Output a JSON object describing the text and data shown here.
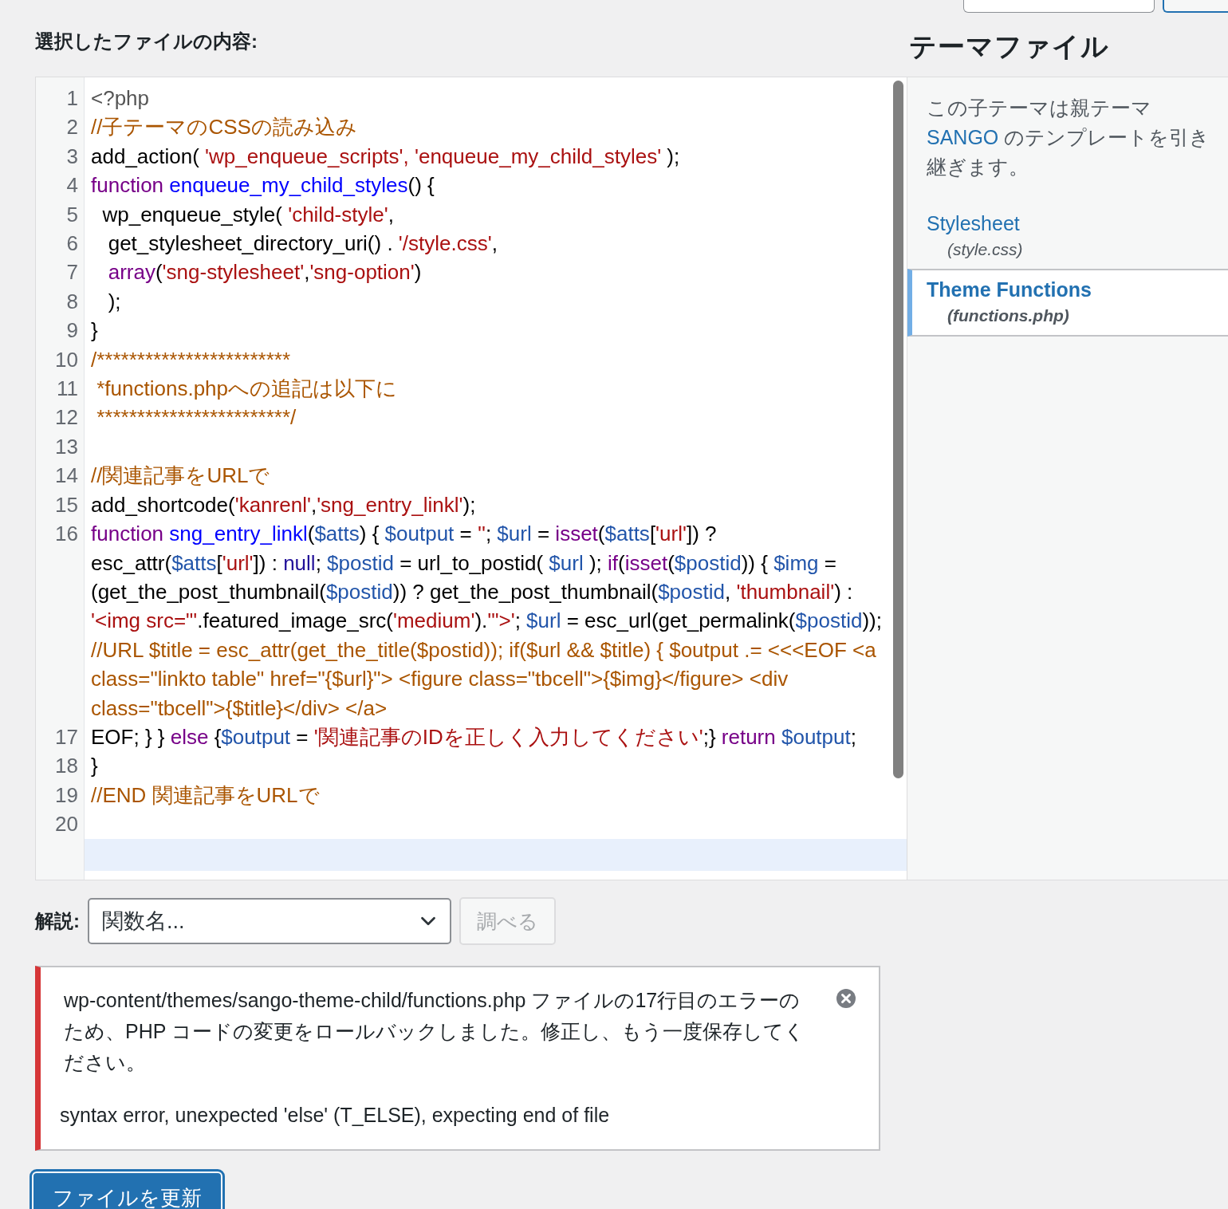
{
  "header": {
    "title": "選択したファイルの内容:"
  },
  "editor": {
    "lines": [
      {
        "number": "1",
        "tokens": [
          {
            "t": "<?php",
            "kind": "meta"
          }
        ]
      },
      {
        "number": "2",
        "tokens": [
          {
            "t": "//子テーマのCSSの読み込み",
            "kind": "comment"
          }
        ]
      },
      {
        "number": "3",
        "tokens": [
          {
            "t": "add_action( ",
            "kind": "plain"
          },
          {
            "t": "'wp_enqueue_scripts',",
            "kind": "string"
          },
          {
            "t": " 'enqueue_my_child_styles'",
            "kind": "string"
          },
          {
            "t": " );",
            "kind": "plain"
          }
        ]
      },
      {
        "number": "4",
        "tokens": [
          {
            "t": "function ",
            "kind": "keyword"
          },
          {
            "t": "enqueue_my_child_styles",
            "kind": "def"
          },
          {
            "t": "() {",
            "kind": "plain"
          }
        ]
      },
      {
        "number": "5",
        "tokens": [
          {
            "t": "  wp_enqueue_style( ",
            "kind": "plain"
          },
          {
            "t": "'child-style'",
            "kind": "string"
          },
          {
            "t": ",",
            "kind": "plain"
          }
        ]
      },
      {
        "number": "6",
        "tokens": [
          {
            "t": "   get_stylesheet_directory_uri() . ",
            "kind": "plain"
          },
          {
            "t": "'/style.css'",
            "kind": "string"
          },
          {
            "t": ",",
            "kind": "plain"
          }
        ]
      },
      {
        "number": "7",
        "tokens": [
          {
            "t": "   array",
            "kind": "keyword"
          },
          {
            "t": "(",
            "kind": "plain"
          },
          {
            "t": "'sng-stylesheet'",
            "kind": "string"
          },
          {
            "t": ",",
            "kind": "plain"
          },
          {
            "t": "'sng-option'",
            "kind": "string"
          },
          {
            "t": ")",
            "kind": "plain"
          }
        ]
      },
      {
        "number": "8",
        "tokens": [
          {
            "t": "   );",
            "kind": "plain"
          }
        ]
      },
      {
        "number": "9",
        "tokens": [
          {
            "t": "}",
            "kind": "plain"
          }
        ]
      },
      {
        "number": "10",
        "tokens": [
          {
            "t": "/************************",
            "kind": "comment"
          }
        ]
      },
      {
        "number": "11",
        "tokens": [
          {
            "t": " *functions.phpへの追記は以下に",
            "kind": "comment"
          }
        ]
      },
      {
        "number": "12",
        "tokens": [
          {
            "t": " ************************/",
            "kind": "comment"
          }
        ]
      },
      {
        "number": "13"
      },
      {
        "number": "14",
        "tokens": [
          {
            "t": "//関連記事をURLで",
            "kind": "comment"
          }
        ]
      },
      {
        "number": "15",
        "tokens": [
          {
            "t": "add_shortcode(",
            "kind": "plain"
          },
          {
            "t": "'kanrenl'",
            "kind": "string"
          },
          {
            "t": ",",
            "kind": "plain"
          },
          {
            "t": "'sng_entry_linkl'",
            "kind": "string"
          },
          {
            "t": ");",
            "kind": "plain"
          }
        ]
      },
      {
        "number": "16",
        "tokens": [
          {
            "t": "function ",
            "kind": "keyword"
          },
          {
            "t": "sng_entry_linkl",
            "kind": "def"
          },
          {
            "t": "(",
            "kind": "plain"
          },
          {
            "t": "$atts",
            "kind": "variable"
          },
          {
            "t": ") { ",
            "kind": "plain"
          },
          {
            "t": "$output",
            "kind": "variable"
          },
          {
            "t": " = ",
            "kind": "plain"
          },
          {
            "t": "''",
            "kind": "string"
          },
          {
            "t": "; ",
            "kind": "plain"
          },
          {
            "t": "$url",
            "kind": "variable"
          },
          {
            "t": " = ",
            "kind": "plain"
          },
          {
            "t": "isset",
            "kind": "keyword"
          },
          {
            "t": "(",
            "kind": "plain"
          },
          {
            "t": "$atts",
            "kind": "variable"
          },
          {
            "t": "[",
            "kind": "plain"
          },
          {
            "t": "'url'",
            "kind": "string"
          },
          {
            "t": "]) ? esc_attr(",
            "kind": "plain"
          },
          {
            "t": "$atts",
            "kind": "variable"
          },
          {
            "t": "[",
            "kind": "plain"
          },
          {
            "t": "'url'",
            "kind": "string"
          },
          {
            "t": "]) : ",
            "kind": "plain"
          },
          {
            "t": "null",
            "kind": "atom"
          },
          {
            "t": "; ",
            "kind": "plain"
          },
          {
            "t": "$postid",
            "kind": "variable"
          },
          {
            "t": " = url_to_postid( ",
            "kind": "plain"
          },
          {
            "t": "$url",
            "kind": "variable"
          },
          {
            "t": " ); ",
            "kind": "plain"
          },
          {
            "t": "if",
            "kind": "keyword"
          },
          {
            "t": "(",
            "kind": "plain"
          },
          {
            "t": "isset",
            "kind": "keyword"
          },
          {
            "t": "(",
            "kind": "plain"
          },
          {
            "t": "$postid",
            "kind": "variable"
          },
          {
            "t": ")) { ",
            "kind": "plain"
          },
          {
            "t": "$img",
            "kind": "variable"
          },
          {
            "t": " = (get_the_post_thumbnail(",
            "kind": "plain"
          },
          {
            "t": "$postid",
            "kind": "variable"
          },
          {
            "t": ")) ? get_the_post_thumbnail(",
            "kind": "plain"
          },
          {
            "t": "$postid",
            "kind": "variable"
          },
          {
            "t": ", ",
            "kind": "plain"
          },
          {
            "t": "'thumbnail'",
            "kind": "string"
          },
          {
            "t": ") : ",
            "kind": "plain"
          },
          {
            "t": "'<img src=\"'",
            "kind": "string"
          },
          {
            "t": ".featured_image_src(",
            "kind": "plain"
          },
          {
            "t": "'medium'",
            "kind": "string"
          },
          {
            "t": ").",
            "kind": "plain"
          },
          {
            "t": "'\">'",
            "kind": "string"
          },
          {
            "t": "; ",
            "kind": "plain"
          },
          {
            "t": "$url",
            "kind": "variable"
          },
          {
            "t": " = esc_url(get_permalink(",
            "kind": "plain"
          },
          {
            "t": "$postid",
            "kind": "variable"
          },
          {
            "t": ")); ",
            "kind": "plain"
          },
          {
            "t": "//URL $title = esc_attr(get_the_title($postid)); if($url && $title) { $output .= <<<EOF <a class=\"linkto table\" href=\"{$url}\"> <figure class=\"tbcell\">{$img}</figure> <div class=\"tbcell\">{$title}</div> </a>",
            "kind": "comment"
          }
        ]
      },
      {
        "number": "17",
        "tokens": [
          {
            "t": "EOF; } } ",
            "kind": "plain"
          },
          {
            "t": "else",
            "kind": "keyword"
          },
          {
            "t": " {",
            "kind": "plain"
          },
          {
            "t": "$output",
            "kind": "variable"
          },
          {
            "t": " = ",
            "kind": "plain"
          },
          {
            "t": "'関連記事のIDを正しく入力してください'",
            "kind": "string"
          },
          {
            "t": ";} ",
            "kind": "plain"
          },
          {
            "t": "return ",
            "kind": "keyword"
          },
          {
            "t": "$output",
            "kind": "variable"
          },
          {
            "t": ";",
            "kind": "plain"
          }
        ]
      },
      {
        "number": "18",
        "tokens": [
          {
            "t": "}",
            "kind": "plain"
          }
        ]
      },
      {
        "number": "19",
        "tokens": [
          {
            "t": "//END 関連記事をURLで",
            "kind": "comment"
          }
        ]
      },
      {
        "number": "20"
      }
    ]
  },
  "sidebar": {
    "title": "テーマファイル",
    "description": {
      "before": "この子テーマは親テーマ ",
      "link": "SANGO",
      "after": " のテンプレートを引き継ぎます。"
    },
    "files": [
      {
        "name": "Stylesheet",
        "file": "(style.css)",
        "selected": false
      },
      {
        "name": "Theme Functions",
        "file": "(functions.php)",
        "selected": true
      }
    ]
  },
  "lookup": {
    "label": "解説:",
    "select": {
      "value": "関数名..."
    },
    "button": {
      "label": "調べる",
      "disabled": true
    }
  },
  "notice": {
    "kind": "error",
    "message": "wp-content/themes/sango-theme-child/functions.php ファイルの17行目のエラーのため、PHP コードの変更をロールバックしました。修正し、もう一度保存してください。",
    "detail": "syntax error, unexpected 'else' (T_ELSE), expecting end of file"
  },
  "submit": {
    "label": "ファイルを更新"
  }
}
